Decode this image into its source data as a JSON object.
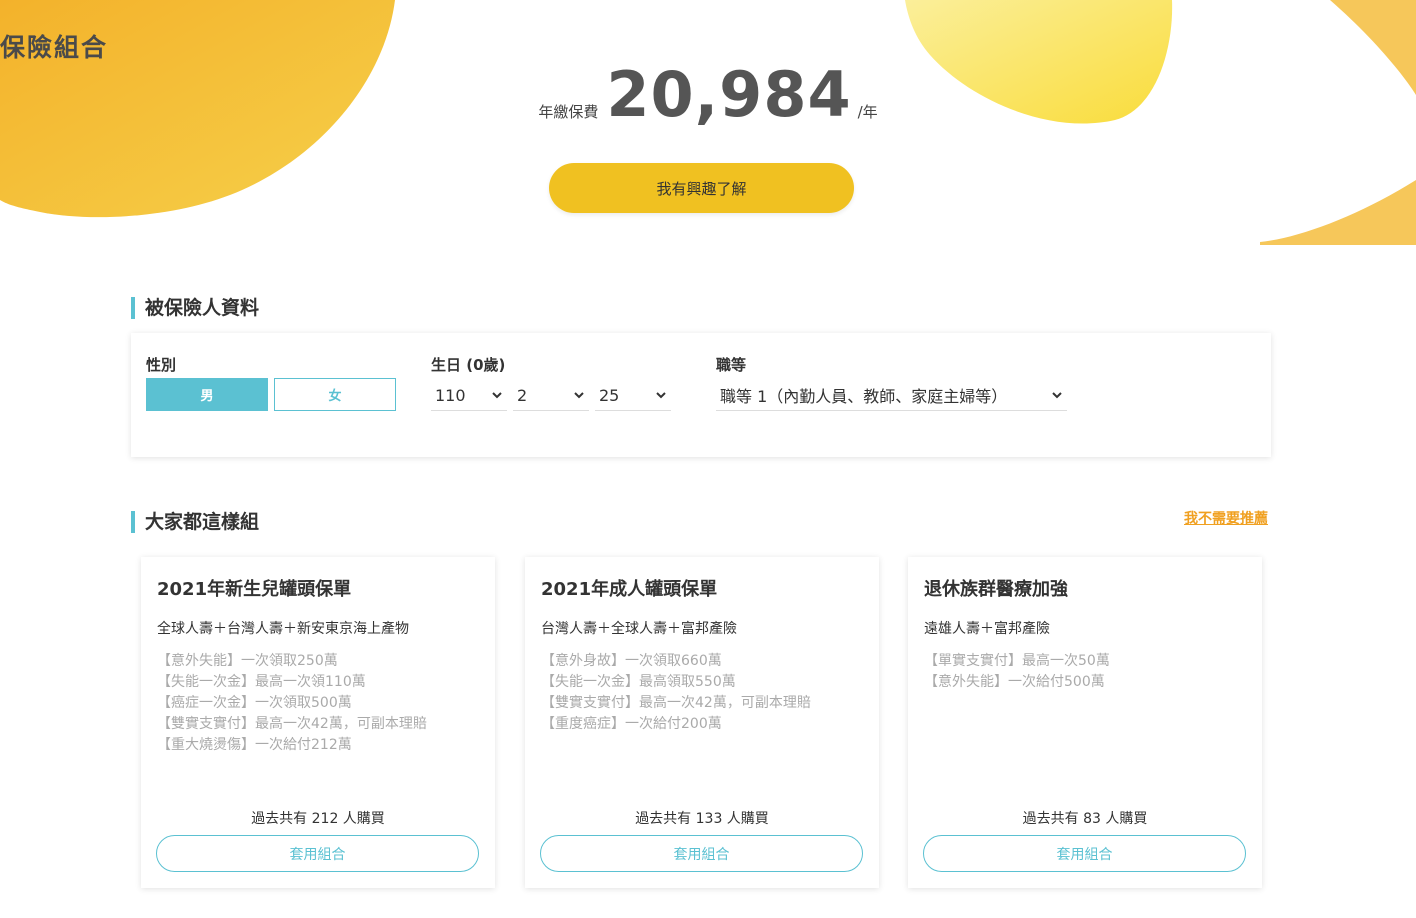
{
  "hero": {
    "title": "保險組合",
    "price_label": "年繳保費",
    "price_value": "20,984",
    "price_unit": "/年",
    "cta_label": "我有興趣了解"
  },
  "insured": {
    "section_title": "被保險人資料",
    "gender_label": "性別",
    "gender_male": "男",
    "gender_female": "女",
    "gender_selected": "男",
    "birthday_label": "生日 (0歲)",
    "birth_year": "110",
    "birth_month": "2",
    "birth_day": "25",
    "occupation_label": "職等",
    "occupation_value": "職等 1（內勤人員、教師、家庭主婦等）"
  },
  "recommend": {
    "section_title": "大家都這樣組",
    "no_rec_link": "我不需要推薦",
    "cards": [
      {
        "title": "2021年新生兒罐頭保單",
        "companies": "全球人壽＋台灣人壽＋新安東京海上產物",
        "features": [
          "【意外失能】一次領取250萬",
          "【失能一次金】最高一次領110萬",
          "【癌症一次金】一次領取500萬",
          "【雙實支實付】最高一次42萬，可副本理賠",
          "【重大燒燙傷】一次給付212萬"
        ],
        "buyers": "過去共有 212 人購買",
        "apply_label": "套用組合"
      },
      {
        "title": "2021年成人罐頭保單",
        "companies": "台灣人壽＋全球人壽＋富邦產險",
        "features": [
          "【意外身故】一次領取660萬",
          "【失能一次金】最高領取550萬",
          "【雙實支實付】最高一次42萬，可副本理賠",
          "【重度癌症】一次給付200萬"
        ],
        "buyers": "過去共有 133 人購買",
        "apply_label": "套用組合"
      },
      {
        "title": "退休族群醫療加強",
        "companies": "遠雄人壽＋富邦產險",
        "features": [
          "【單實支實付】最高一次50萬",
          "【意外失能】一次給付500萬"
        ],
        "buyers": "過去共有 83 人購買",
        "apply_label": "套用組合"
      }
    ]
  },
  "colors": {
    "accent_teal": "#5bc1d2",
    "accent_yellow": "#f0c121",
    "link_orange": "#f0a020"
  }
}
